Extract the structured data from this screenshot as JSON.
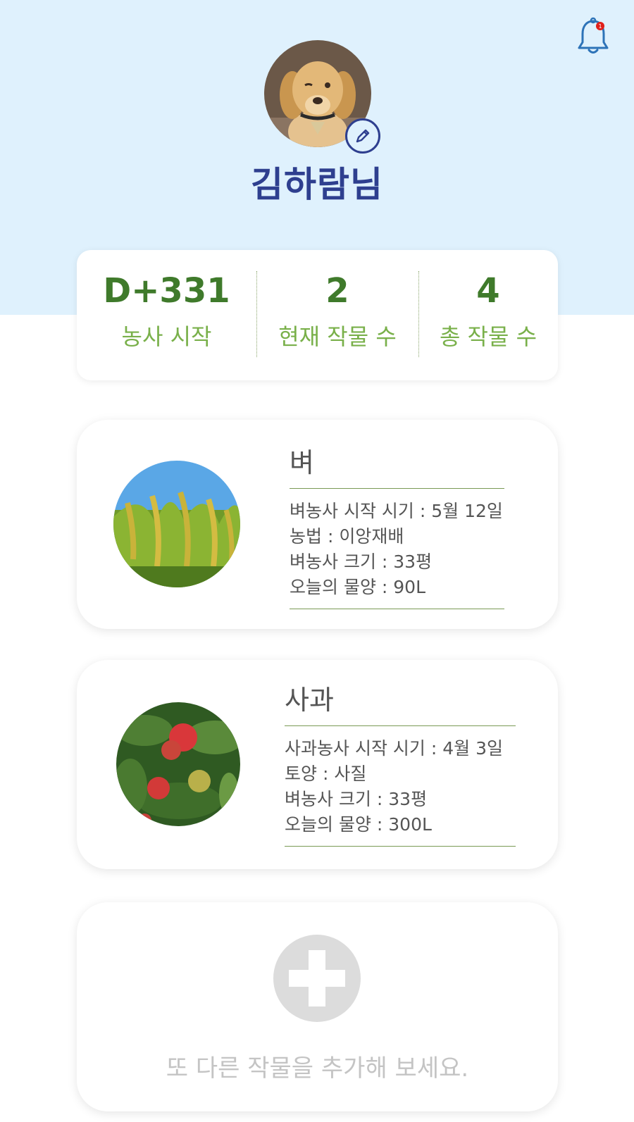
{
  "header": {
    "notification_count": "1",
    "username": "김하람님"
  },
  "stats": [
    {
      "value": "D+331",
      "label": "농사 시작"
    },
    {
      "value": "2",
      "label": "현재 작물 수"
    },
    {
      "value": "4",
      "label": "총 작물 수"
    }
  ],
  "crops": [
    {
      "name": "벼",
      "details": [
        "벼농사 시작 시기 : 5월 12일",
        "농법 : 이앙재배",
        "벼농사 크기 : 33평",
        "오늘의 물양 : 90L"
      ]
    },
    {
      "name": "사과",
      "details": [
        "사과농사 시작 시기 : 4월 3일",
        "토양 : 사질",
        "벼농사 크기 : 33평",
        "오늘의 물양 : 300L"
      ]
    }
  ],
  "add_card": {
    "text": "또 다른 작물을 추가해 보세요."
  },
  "colors": {
    "header_bg": "#dff1fd",
    "username": "#2e3f8f",
    "stat_value": "#3f7a2b",
    "stat_label": "#79b04a",
    "notification_dot": "#e0201a"
  },
  "icons": {
    "notification": "bell-icon",
    "edit": "pencil-icon",
    "add": "plus-icon"
  }
}
